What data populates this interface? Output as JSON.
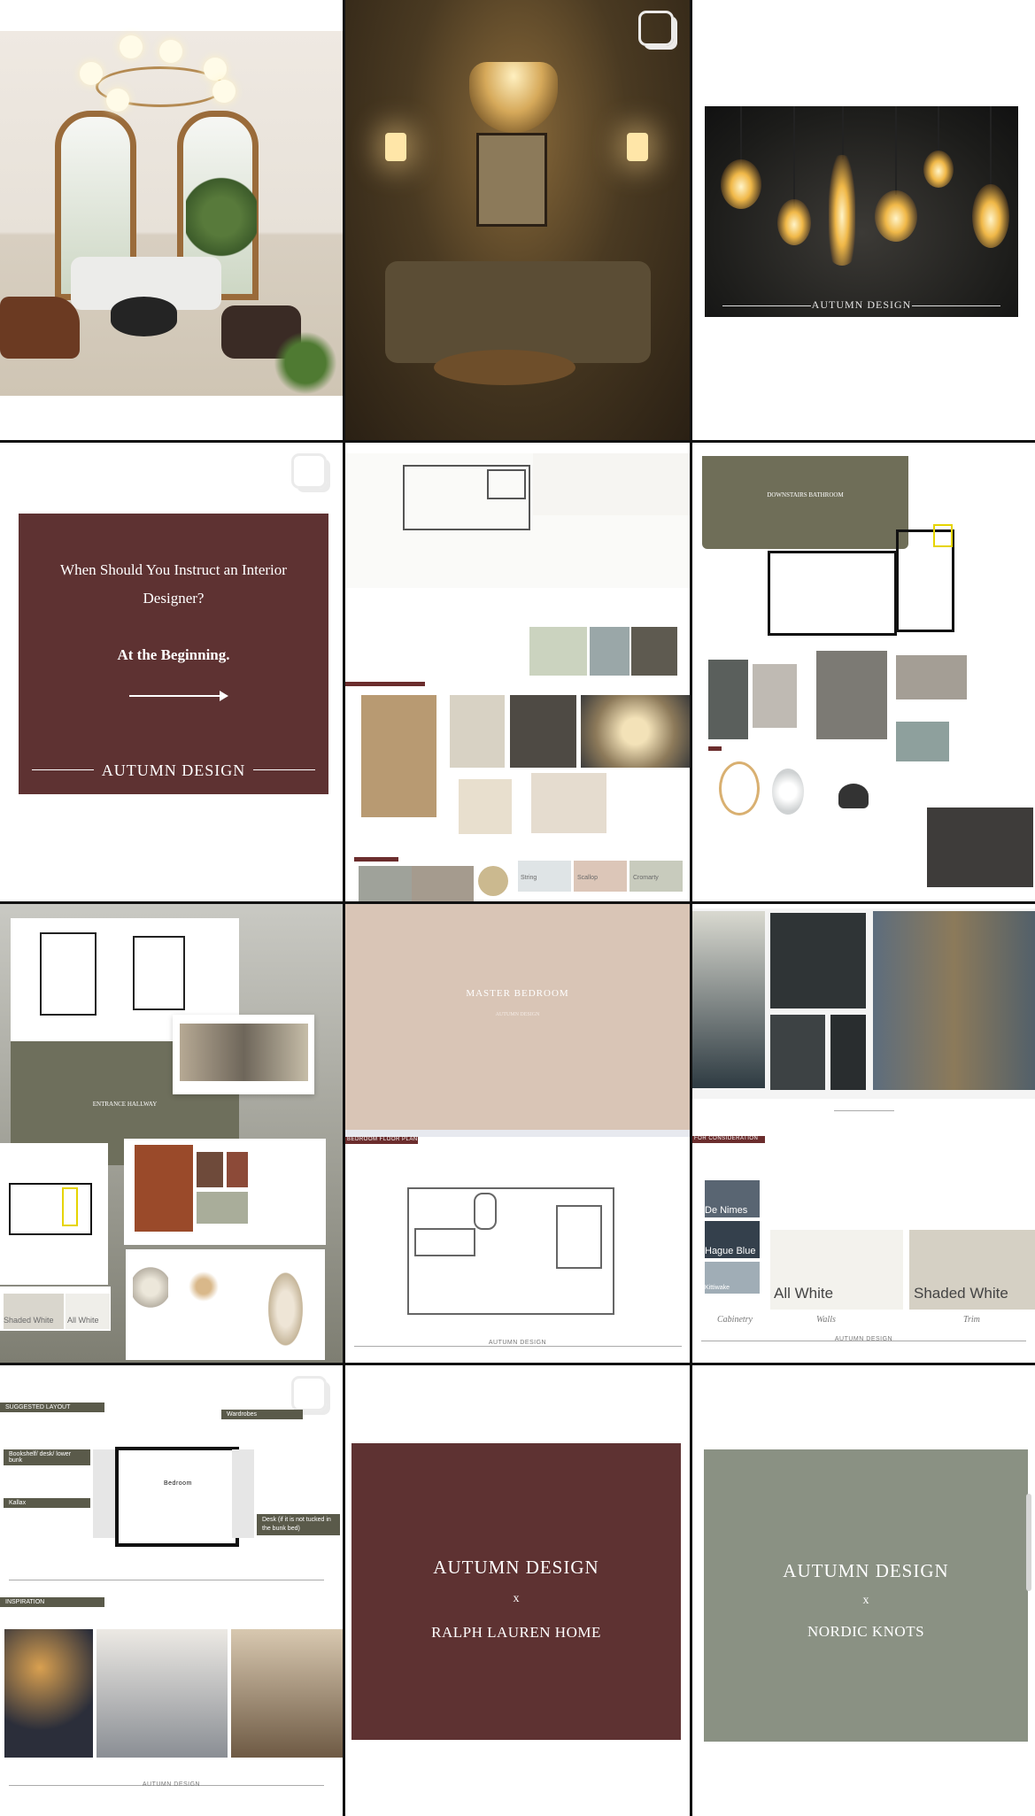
{
  "tiles": {
    "instruct": {
      "question": "When Should You Instruct an Interior Designer?",
      "answer": "At the Beginning.",
      "brand": "AUTUMN DESIGN"
    },
    "bulbs": {
      "brand": "AUTUMN DESIGN"
    },
    "downstairs": {
      "title": "DOWNSTAIRS BATHROOM"
    },
    "hallway": {
      "title": "ENTRANCE HALLWAY",
      "swatch1": "Shaded White",
      "swatch2": "All White"
    },
    "bedroom": {
      "title": "MASTER BEDROOM",
      "subtitle": "AUTUMN DESIGN",
      "plan_label": "BEDROOM FLOOR PLAN",
      "footer": "AUTUMN DESIGN"
    },
    "palette": {
      "label": "FOR CONSIDERATION",
      "colors": [
        "De Nimes",
        "Hague Blue",
        "Kittiwake"
      ],
      "big1": "All White",
      "big2": "Shaded White",
      "cap1": "Cabinetry",
      "cap2": "Walls",
      "cap3": "Trim",
      "footer": "AUTUMN DESIGN"
    },
    "layout": {
      "header": "SUGGESTED LAYOUT",
      "l1": "Wardrobes",
      "l2": "Bookshelf/ desk/ lower bunk",
      "l3": "Kallax",
      "l4": "Desk (if it is not tucked in the bunk bed)",
      "room": "Bedroom",
      "inspo": "INSPIRATION",
      "footer": "AUTUMN DESIGN"
    },
    "lighting": {
      "swatches": [
        "String",
        "Scallop",
        "Cromarty"
      ]
    },
    "ralph": {
      "line1": "AUTUMN DESIGN",
      "x": "x",
      "line2": "RALPH LAUREN HOME"
    },
    "nordic": {
      "line1": "AUTUMN DESIGN",
      "x": "x",
      "line2": "NORDIC KNOTS"
    }
  },
  "colors": {
    "maroon": "#5e3232",
    "olive": "#6f6e58",
    "sage": "#8a9183",
    "blush": "#d9c5b6"
  }
}
